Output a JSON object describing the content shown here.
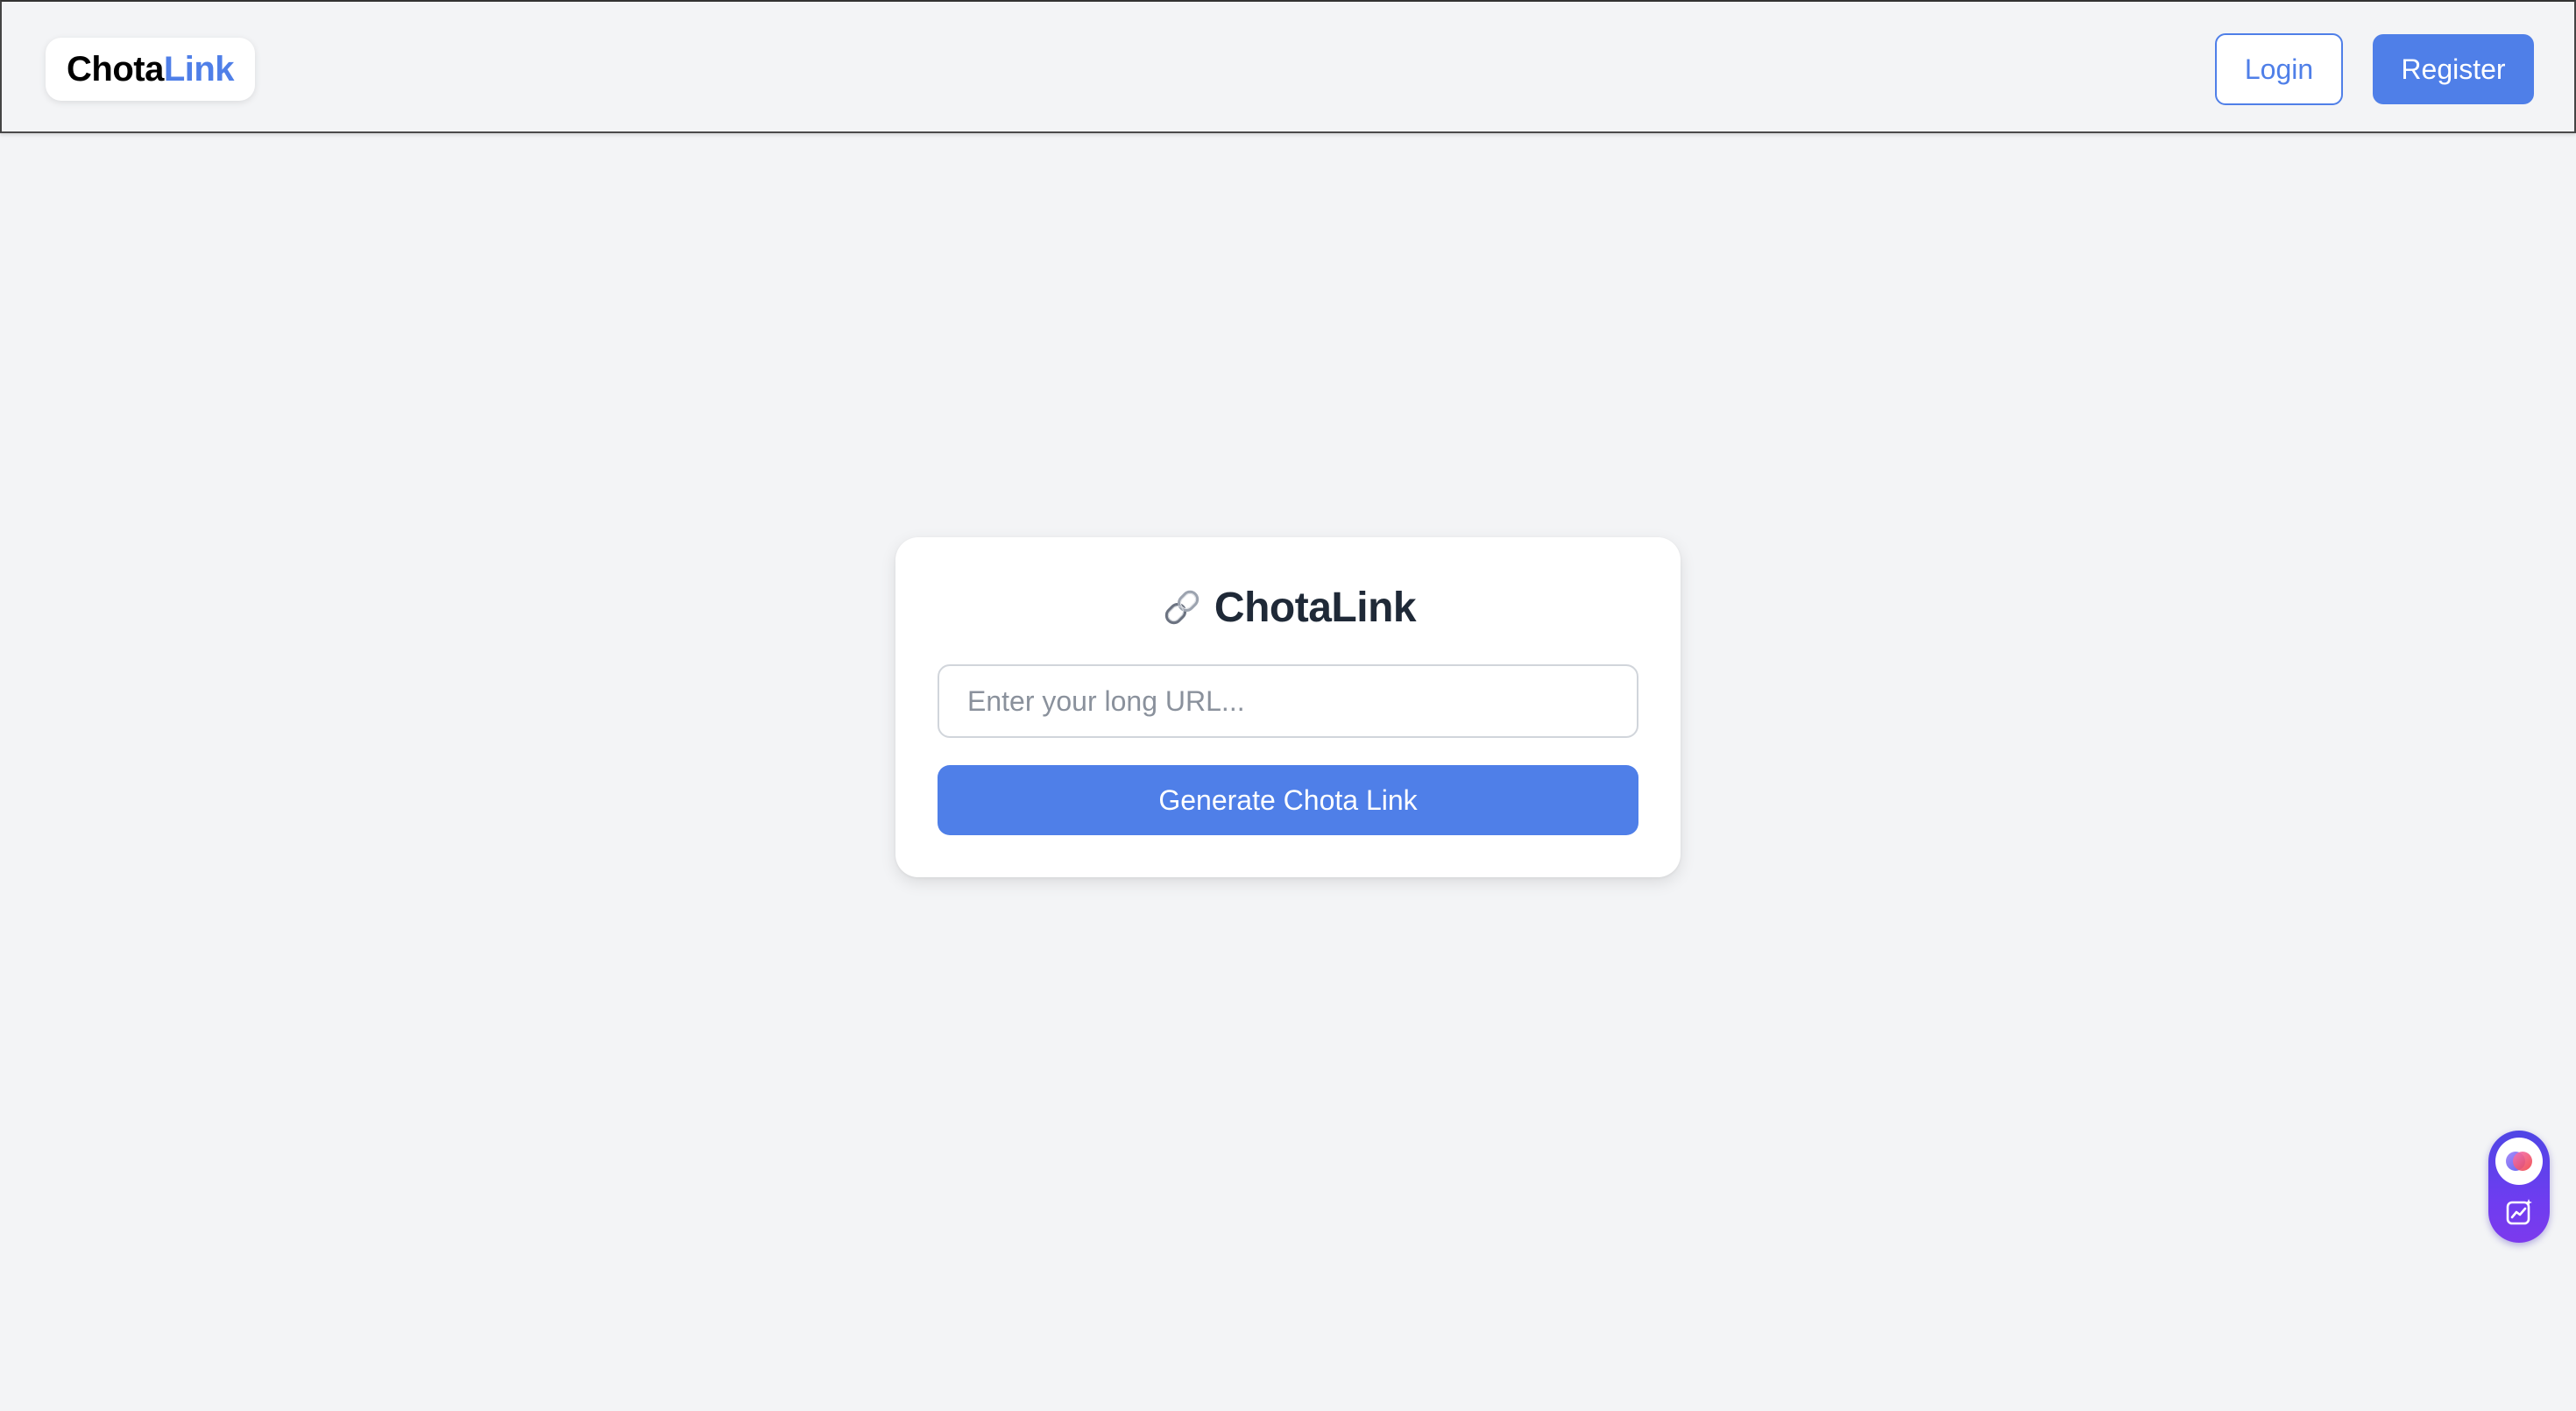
{
  "header": {
    "brand_part_a": "Chota",
    "brand_part_b": "Link",
    "login_label": "Login",
    "register_label": "Register"
  },
  "main": {
    "title_icon": "link-icon",
    "title": "ChotaLink",
    "url_input": {
      "placeholder": "Enter your long URL...",
      "value": ""
    },
    "generate_label": "Generate Chota Link"
  },
  "floating_widget": {
    "top_icon": "assistant-orb-icon",
    "bottom_icon": "chart-sparkle-icon"
  },
  "colors": {
    "accent": "#4f7fe8",
    "background": "#f3f4f6",
    "card": "#ffffff",
    "title_text": "#1f2937",
    "widget_gradient_start": "#4f46e5",
    "widget_gradient_end": "#7c3aed"
  }
}
